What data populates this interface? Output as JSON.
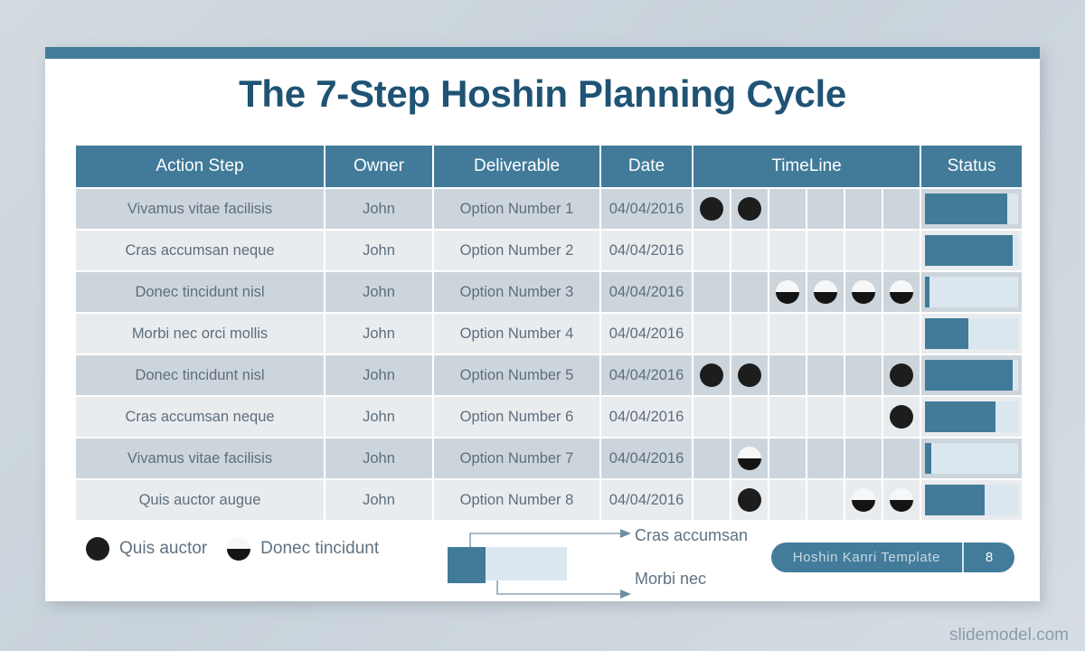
{
  "slide": {
    "title": "The 7-Step Hoshin Planning Cycle",
    "watermark": "slidemodel.com",
    "accent_color": "#417b99",
    "title_color": "#1f5375",
    "row_odd_color": "#cdd5dc",
    "row_even_color": "#e9ecef",
    "status_track_color": "#dbe7ef",
    "marker_color": "#1d1d1d"
  },
  "table": {
    "headers": {
      "action_step": "Action Step",
      "owner": "Owner",
      "deliverable": "Deliverable",
      "date": "Date",
      "timeline": "TimeLine",
      "status": "Status"
    },
    "timeline_columns": 6,
    "rows": [
      {
        "action_step": "Vivamus vitae facilisis",
        "owner": "John",
        "deliverable": "Option Number 1",
        "date": "04/04/2016",
        "timeline": [
          "full",
          "full",
          "none",
          "none",
          "none",
          "none"
        ],
        "status_percent": 88
      },
      {
        "action_step": "Cras accumsan neque",
        "owner": "John",
        "deliverable": "Option Number 2",
        "date": "04/04/2016",
        "timeline": [
          "none",
          "none",
          "none",
          "none",
          "none",
          "none"
        ],
        "status_percent": 94
      },
      {
        "action_step": "Donec tincidunt nisl",
        "owner": "John",
        "deliverable": "Option Number 3",
        "date": "04/04/2016",
        "timeline": [
          "none",
          "none",
          "half",
          "half",
          "half",
          "half"
        ],
        "status_percent": 5
      },
      {
        "action_step": "Morbi nec orci mollis",
        "owner": "John",
        "deliverable": "Option Number 4",
        "date": "04/04/2016",
        "timeline": [
          "none",
          "none",
          "none",
          "none",
          "none",
          "none"
        ],
        "status_percent": 47
      },
      {
        "action_step": "Donec tincidunt nisl",
        "owner": "John",
        "deliverable": "Option Number 5",
        "date": "04/04/2016",
        "timeline": [
          "full",
          "full",
          "none",
          "none",
          "none",
          "full"
        ],
        "status_percent": 94
      },
      {
        "action_step": "Cras accumsan neque",
        "owner": "John",
        "deliverable": "Option Number 6",
        "date": "04/04/2016",
        "timeline": [
          "none",
          "none",
          "none",
          "none",
          "none",
          "full"
        ],
        "status_percent": 76
      },
      {
        "action_step": "Vivamus vitae facilisis",
        "owner": "John",
        "deliverable": "Option Number 7",
        "date": "04/04/2016",
        "timeline": [
          "none",
          "half",
          "none",
          "none",
          "none",
          "none"
        ],
        "status_percent": 7
      },
      {
        "action_step": "Quis auctor augue",
        "owner": "John",
        "deliverable": "Option Number 8",
        "date": "04/04/2016",
        "timeline": [
          "none",
          "full",
          "none",
          "none",
          "half",
          "half"
        ],
        "status_percent": 64
      }
    ]
  },
  "legend": {
    "items": [
      {
        "marker": "full",
        "label": "Quis auctor"
      },
      {
        "marker": "half",
        "label": "Donec tincidunt"
      }
    ]
  },
  "callout": {
    "label_top": "Cras accumsan",
    "label_bottom": "Morbi nec"
  },
  "footer": {
    "template_name": "Hoshin Kanri Template",
    "page_number": "8"
  }
}
